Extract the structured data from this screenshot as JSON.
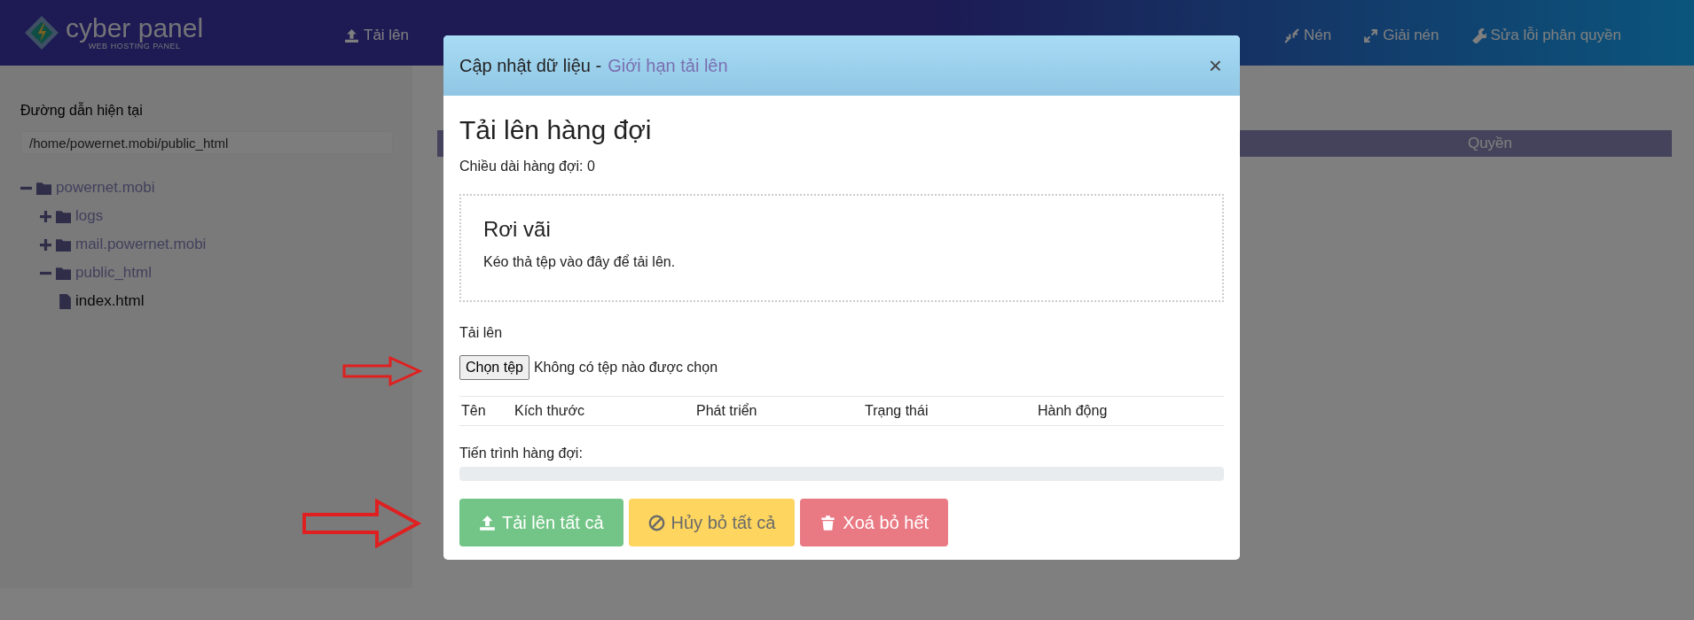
{
  "header": {
    "logo": {
      "name": "cyber panel",
      "tagline": "WEB HOSTING PANEL"
    },
    "toolbar_left": [
      "Tải lên"
    ],
    "toolbar_right": [
      "Nén",
      "Giải nén",
      "Sửa lỗi phân quyền"
    ]
  },
  "sidebar": {
    "path_label": "Đường dẫn hiện tại",
    "path_value": "/home/powernet.mobi/public_html",
    "tree": [
      {
        "name": "powernet.mobi",
        "kind": "folder",
        "expanded": true,
        "children": [
          {
            "name": "logs",
            "kind": "folder",
            "expanded": false
          },
          {
            "name": "mail.powernet.mobi",
            "kind": "folder",
            "expanded": false
          },
          {
            "name": "public_html",
            "kind": "folder",
            "expanded": true,
            "children": [
              {
                "name": "index.html",
                "kind": "file"
              }
            ]
          }
        ]
      }
    ]
  },
  "file_table": {
    "columns": [
      "Quyền"
    ]
  },
  "modal": {
    "title": "Cập nhật dữ liệu -",
    "title_link": "Giới hạn tải lên",
    "close": "×",
    "heading": "Tải lên hàng đợi",
    "queue_length": "Chiều dài hàng đợi: 0",
    "dropzone": {
      "title": "Rơi vãi",
      "hint": "Kéo thả tệp vào đây để tải lên."
    },
    "upload_label": "Tải lên",
    "file_input": {
      "button": "Chọn tệp",
      "status": "Không có tệp nào được chọn"
    },
    "queue_table": {
      "columns": [
        "Tên",
        "Kích thước",
        "Phát triển",
        "Trạng thái",
        "Hành động"
      ]
    },
    "progress": {
      "label": "Tiến trình hàng đợi:",
      "level": 0
    },
    "buttons": [
      {
        "label": "Tải lên tất cả",
        "kind": "success"
      },
      {
        "label": "Hủy bỏ tất cả",
        "kind": "warning"
      },
      {
        "label": "Xoá bỏ hết",
        "kind": "danger"
      }
    ]
  }
}
